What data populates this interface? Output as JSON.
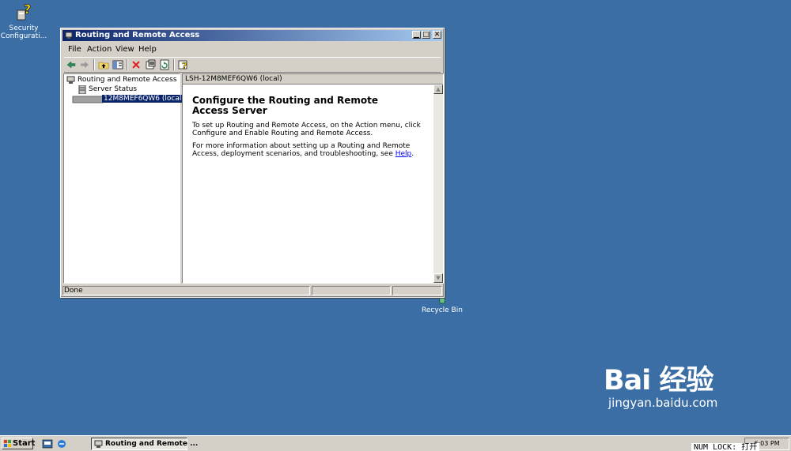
{
  "desktop": {
    "security_icon_label": "Security Configurati...",
    "recycle_bin_label": "Recycle Bin"
  },
  "window": {
    "title": "Routing and Remote Access",
    "menu": {
      "file": "File",
      "action": "Action",
      "view": "View",
      "help": "Help"
    },
    "tree": {
      "root": "Routing and Remote Access",
      "server_status": "Server Status",
      "server": "12M8MEF6QW6 (local)"
    },
    "right_pane": {
      "header": "LSH-12M8MEF6QW6 (local)",
      "heading_line1": "Configure the Routing and Remote",
      "heading_line2": "Access Server",
      "para1": "To set up Routing and Remote Access, on the Action menu, click Configure and Enable Routing and Remote Access.",
      "para2_before_link": "For more information about setting up a Routing and Remote Access, deployment scenarios, and troubleshooting, see ",
      "help_link": "Help",
      "para2_after_link": "."
    },
    "status": "Done"
  },
  "taskbar": {
    "start": "Start",
    "task_button": "Routing and Remote ...",
    "clock": "6:03 PM"
  },
  "overlay": {
    "numlock": "NUM LOCK: 打开",
    "watermark_big": "Bai 经验",
    "watermark_small": "jingyan.baidu.com"
  }
}
